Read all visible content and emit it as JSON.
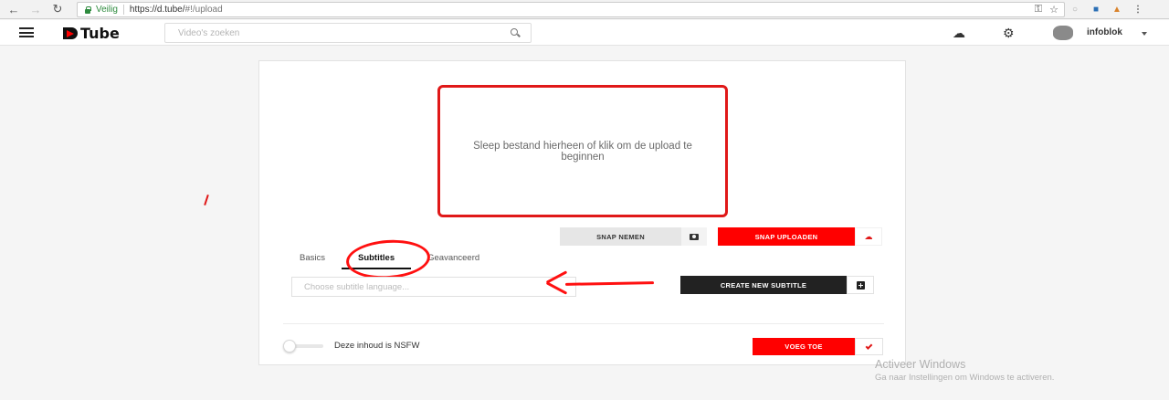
{
  "browser": {
    "secure_label": "Veilig",
    "url_host": "https://d.tube/",
    "url_path": "#!/upload"
  },
  "header": {
    "logo_text": "Tube",
    "search_placeholder": "Video's zoeken",
    "username": "infoblok"
  },
  "upload": {
    "dropzone_text": "Sleep bestand hierheen of klik om de upload te beginnen",
    "snap_take_label": "SNAP NEMEN",
    "snap_upload_label": "SNAP UPLOADEN"
  },
  "tabs": [
    {
      "label": "Basics",
      "active": false
    },
    {
      "label": "Subtitles",
      "active": true
    },
    {
      "label": "Geavanceerd",
      "active": false
    }
  ],
  "subtitles": {
    "language_placeholder": "Choose subtitle language...",
    "create_label": "CREATE NEW SUBTITLE"
  },
  "footer": {
    "nsfw_label": "Deze inhoud is NSFW",
    "nsfw_enabled": false,
    "add_label": "VOEG TOE"
  },
  "watermark": {
    "title": "Activeer Windows",
    "subtitle": "Ga naar Instellingen om Windows te activeren."
  },
  "colors": {
    "accent": "#ff0000",
    "annotation": "#ff1010"
  }
}
